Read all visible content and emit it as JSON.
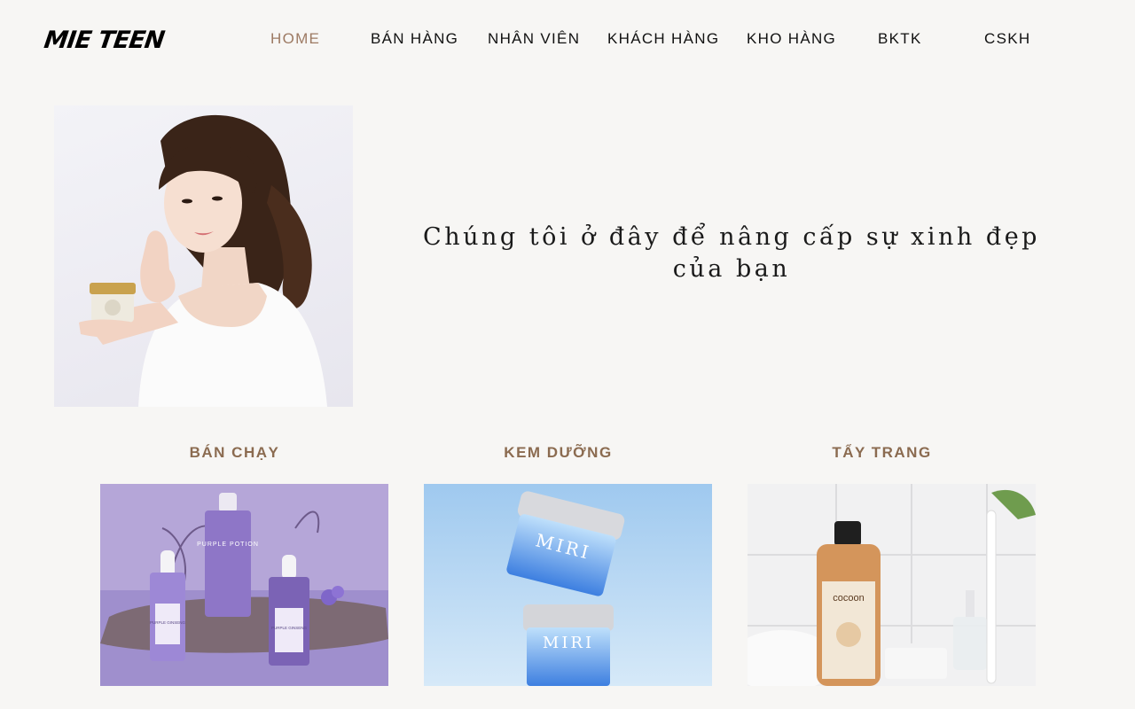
{
  "header": {
    "logo": "MIE TEEN",
    "nav": [
      {
        "label": "HOME",
        "active": true
      },
      {
        "label": "BÁN HÀNG"
      },
      {
        "label": "NHÂN VIÊN"
      },
      {
        "label": "KHÁCH HÀNG"
      },
      {
        "label": "KHO HÀNG"
      },
      {
        "label": "BKTK"
      },
      {
        "label": "CSKH"
      }
    ]
  },
  "hero": {
    "tagline_line1": "Chúng tôi ở đây để nâng cấp sự xinh đẹp",
    "tagline_line2": "của bạn"
  },
  "categories": [
    {
      "title": "BÁN CHẠY",
      "product_labels": [
        "PURPLE POTION",
        "PURPLE GINSENG",
        "PURPLE GINSENG"
      ]
    },
    {
      "title": "KEM DƯỠNG",
      "product_labels": [
        "MIRI",
        "MIRI"
      ]
    },
    {
      "title": "TẨY TRANG",
      "product_labels": [
        "cocoon"
      ]
    }
  ],
  "colors": {
    "background": "#f7f6f4",
    "nav_active": "#9d7a63",
    "category_title": "#8b6b50"
  }
}
